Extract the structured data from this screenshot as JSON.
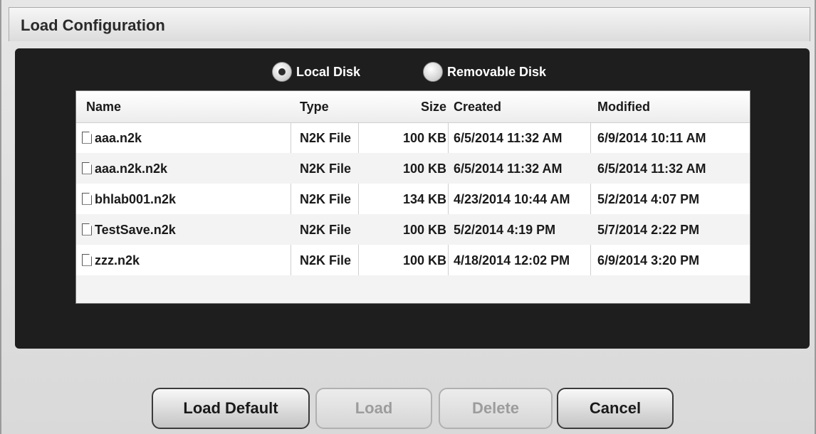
{
  "window": {
    "title": "Load Configuration"
  },
  "source": {
    "options": [
      {
        "label": "Local Disk",
        "checked": true
      },
      {
        "label": "Removable Disk",
        "checked": false
      }
    ]
  },
  "table": {
    "columns": [
      "Name",
      "Type",
      "Size",
      "Created",
      "Modified"
    ],
    "rows": [
      {
        "name": "aaa.n2k",
        "type": "N2K File",
        "size": "100 KB",
        "created": "6/5/2014 11:32 AM",
        "modified": "6/9/2014 10:11 AM"
      },
      {
        "name": "aaa.n2k.n2k",
        "type": "N2K File",
        "size": "100 KB",
        "created": "6/5/2014 11:32 AM",
        "modified": "6/5/2014 11:32 AM"
      },
      {
        "name": "bhlab001.n2k",
        "type": "N2K File",
        "size": "134 KB",
        "created": "4/23/2014 10:44 AM",
        "modified": "5/2/2014 4:07 PM"
      },
      {
        "name": "TestSave.n2k",
        "type": "N2K File",
        "size": "100 KB",
        "created": "5/2/2014 4:19 PM",
        "modified": "5/7/2014 2:22 PM"
      },
      {
        "name": "zzz.n2k",
        "type": "N2K File",
        "size": "100 KB",
        "created": "4/18/2014 12:02 PM",
        "modified": "6/9/2014 3:20 PM"
      }
    ]
  },
  "buttons": {
    "load_default": {
      "label": "Load Default",
      "enabled": true
    },
    "load": {
      "label": "Load",
      "enabled": false
    },
    "delete": {
      "label": "Delete",
      "enabled": false
    },
    "cancel": {
      "label": "Cancel",
      "enabled": true
    }
  },
  "icons": {
    "file": "file-icon",
    "radio": "radio-icon"
  }
}
